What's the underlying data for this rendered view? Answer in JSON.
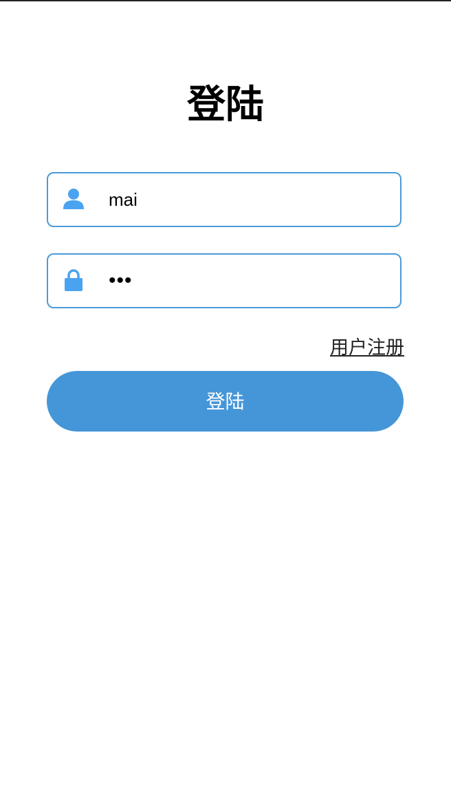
{
  "page": {
    "title": "登陆"
  },
  "form": {
    "username": {
      "value": "mai",
      "icon": "user-icon"
    },
    "password": {
      "value": "•••",
      "icon": "lock-icon"
    },
    "register_link": "用户注册",
    "login_button": "登陆"
  },
  "colors": {
    "accent": "#4596d8",
    "border": "#4a9ad8",
    "icon": "#4aa3f0"
  }
}
